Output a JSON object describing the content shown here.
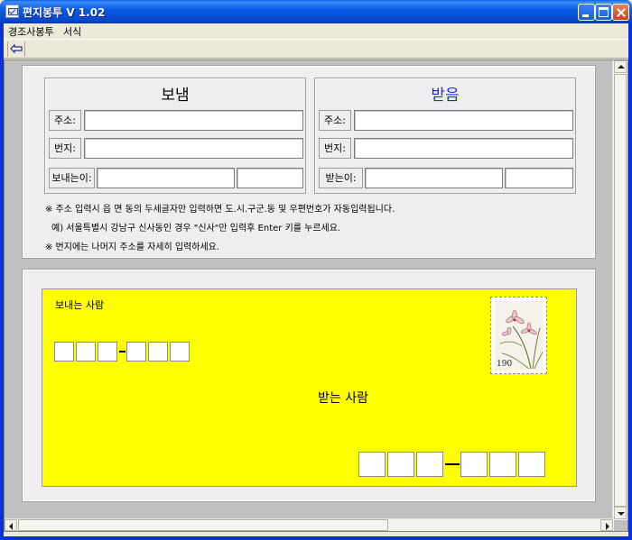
{
  "window": {
    "title": "편지봉투 V 1.02",
    "controls": [
      "minimize",
      "maximize",
      "close"
    ]
  },
  "menu": {
    "items": [
      "경조사봉투",
      "서식"
    ]
  },
  "toolbar": {
    "back_icon": "back-arrow-icon"
  },
  "sender": {
    "title": "보냄",
    "address_label": "주소:",
    "address_value": "",
    "detail_label": "번지:",
    "detail_value": "",
    "name_label": "보내는이:",
    "name_value": "",
    "name_extra_value": ""
  },
  "receiver": {
    "title": "받음",
    "title_color": "#1f2fdc",
    "address_label": "주소:",
    "address_value": "",
    "detail_label": "번지:",
    "detail_value": "",
    "name_label": "받는이:",
    "name_value": "",
    "name_extra_value": ""
  },
  "notes": [
    "※  주소 입력시 읍 면 동의 두세글자만 입력하면 도.시.구군.동 및 우편번호가 자동입력됩니다.",
    "예) 서울특별시 강남구 신사동인 경우 \"신사\"만 입력후 Enter 키를 누르세요.",
    "※  번지에는 나머지 주소를 자세히 입력하세요."
  ],
  "envelope": {
    "background": "#ffff00",
    "sender_label": "보내는 사람",
    "receiver_label": "받는 사람",
    "stamp_value": "190",
    "stamp_icon": "orchid-stamp-icon"
  }
}
